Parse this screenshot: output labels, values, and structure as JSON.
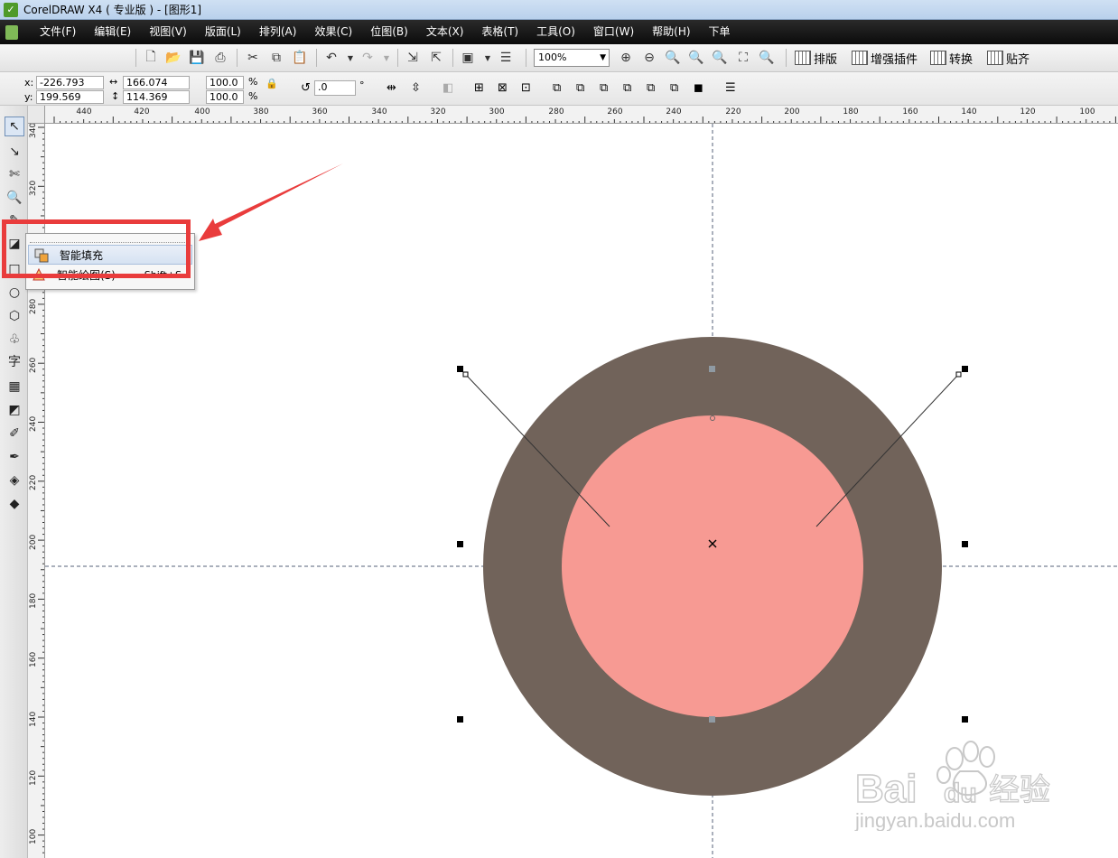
{
  "window": {
    "title": "CorelDRAW X4 ( 专业版 ) - [图形1]"
  },
  "menu": {
    "items": [
      "文件(F)",
      "编辑(E)",
      "视图(V)",
      "版面(L)",
      "排列(A)",
      "效果(C)",
      "位图(B)",
      "文本(X)",
      "表格(T)",
      "工具(O)",
      "窗口(W)",
      "帮助(H)",
      "下单"
    ]
  },
  "toolbar": {
    "zoom": "100%",
    "plugin_buttons": [
      "排版",
      "增强插件",
      "转换",
      "贴齐"
    ]
  },
  "property_bar": {
    "x_label": "x:",
    "x_value": "-226.793 mm",
    "y_label": "y:",
    "y_value": "199.569 mm",
    "width_value": "166.074 mm",
    "height_value": "114.369 mm",
    "scale_w": "100.0",
    "scale_h": "100.0",
    "percent": "%",
    "rotation_value": ".0",
    "degree": "°"
  },
  "rulers": {
    "top_labels": [
      "440",
      "420",
      "400",
      "380",
      "360",
      "340",
      "320",
      "300",
      "280",
      "260",
      "240",
      "220",
      "200",
      "180",
      "160",
      "140",
      "120",
      "100"
    ],
    "left_labels": [
      "340",
      "320",
      "280",
      "260",
      "240",
      "220",
      "200",
      "180",
      "160",
      "140",
      "120",
      "100"
    ]
  },
  "flyout": {
    "items": [
      {
        "label": "智能填充",
        "shortcut": ""
      },
      {
        "label": "智能绘图(S)",
        "shortcut": "Shift+S"
      }
    ]
  },
  "canvas": {
    "outer_circle_color": "#71635a",
    "inner_circle_color": "#f79a93"
  },
  "annotation": {
    "color": "#e93c3c"
  },
  "watermark": {
    "brand": "Bai",
    "brand_suffix": "du",
    "brand_cn": "经验",
    "url": "jingyan.baidu.com"
  }
}
